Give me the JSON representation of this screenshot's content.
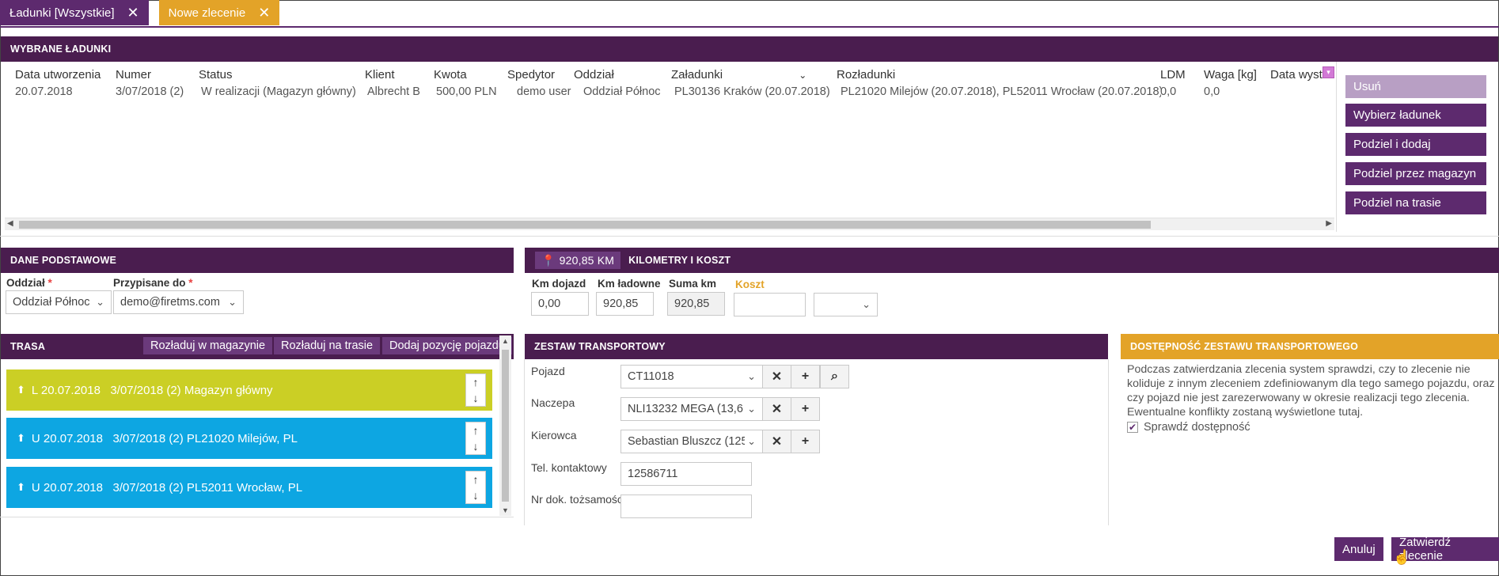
{
  "tabs": [
    {
      "label": "Ładunki [Wszystkie]"
    },
    {
      "label": "Nowe zlecenie"
    }
  ],
  "selected": {
    "title": "WYBRANE ŁADUNKI",
    "headers": [
      "Data utworzenia",
      "Numer",
      "Status",
      "Klient",
      "Kwota",
      "Spedytor",
      "Oddział",
      "Załadunki",
      "Rozładunki",
      "LDM",
      "Waga [kg]",
      "Data wystaw"
    ],
    "row": [
      "20.07.2018",
      "3/07/2018 (2)",
      "W realizacji (Magazyn główny)",
      "Albrecht B",
      "500,00 PLN",
      "demo user",
      "Oddział Północ",
      "PL30136 Kraków (20.07.2018)",
      "PL21020 Milejów (20.07.2018), PL52011 Wrocław (20.07.2018)",
      "0,0",
      "0,0",
      ""
    ],
    "actions": [
      "Usuń",
      "Wybierz ładunek",
      "Podziel i dodaj",
      "Podziel przez magazyn",
      "Podziel na trasie"
    ]
  },
  "basic": {
    "title": "DANE PODSTAWOWE",
    "branch_label": "Oddział",
    "branch_value": "Oddział Północ",
    "assigned_label": "Przypisane do",
    "assigned_value": "demo@firetms.com"
  },
  "km": {
    "badge": "920,85 KM",
    "title": "KILOMETRY I KOSZT",
    "labels": {
      "dojazd": "Km dojazd",
      "ladowne": "Km ładowne",
      "suma": "Suma km",
      "koszt": "Koszt"
    },
    "values": {
      "dojazd": "0,00",
      "ladowne": "920,85",
      "suma": "920,85",
      "koszt": ""
    }
  },
  "route": {
    "title": "TRASA",
    "buttons": [
      "Rozładuj w magazynie",
      "Rozładuj na trasie",
      "Dodaj pozycję pojazdu"
    ],
    "items": [
      {
        "text": "L 20.07.2018   3/07/2018 (2) Magazyn główny",
        "color": "#cbcf25"
      },
      {
        "text": "U 20.07.2018   3/07/2018 (2) PL21020 Milejów, PL",
        "color": "#0da6e2"
      },
      {
        "text": "U 20.07.2018   3/07/2018 (2) PL52011 Wrocław, PL",
        "color": "#0da6e2"
      }
    ]
  },
  "transport": {
    "title": "ZESTAW TRANSPORTOWY",
    "fields": {
      "pojazd_label": "Pojazd",
      "pojazd_value": "CT11018",
      "naczepa_label": "Naczepa",
      "naczepa_value": "NLI13232 MEGA (13,6",
      "kierowca_label": "Kierowca",
      "kierowca_value": "Sebastian Bluszcz (125",
      "tel_label": "Tel. kontaktowy",
      "tel_value": "12586711",
      "dok_label": "Nr dok. tożsamości",
      "dok_value": ""
    }
  },
  "availability": {
    "title": "DOSTĘPNOŚĆ ZESTAWU TRANSPORTOWEGO",
    "text": "Podczas zatwierdzania zlecenia system sprawdzi, czy to zlecenie nie koliduje z innym zleceniem zdefiniowanym dla tego samego pojazdu, oraz czy pojazd nie jest zarezerwowany w okresie realizacji tego zlecenia. Ewentualne konflikty zostaną wyświetlone tutaj.",
    "check_label": "Sprawdź dostępność",
    "checked": true
  },
  "footer": {
    "cancel": "Anuluj",
    "confirm": "Zatwierdź zlecenie"
  },
  "colors": {
    "purple": "#5d2a6e",
    "header": "#4a1d4f",
    "orange": "#e3a328",
    "green": "#cbcf25",
    "blue": "#0da6e2"
  }
}
